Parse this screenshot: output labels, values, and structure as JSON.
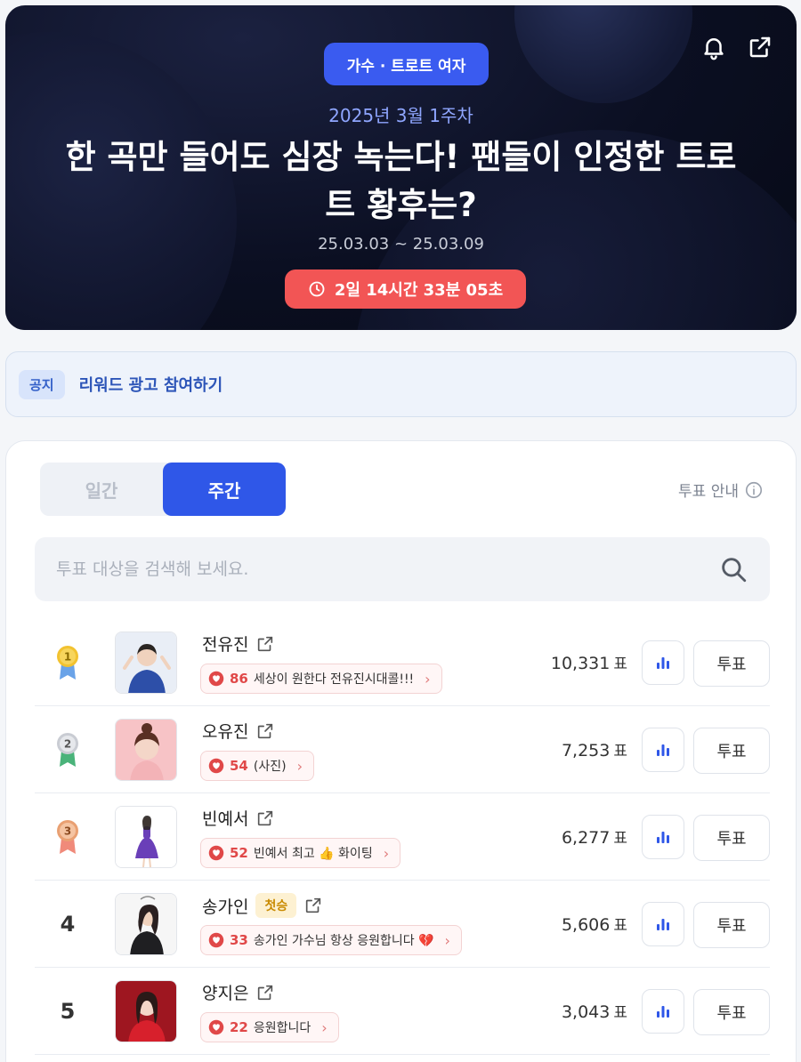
{
  "hero": {
    "category": "가수 · 트로트 여자",
    "week": "2025년 3월 1주차",
    "title": "한 곡만 들어도 심장 녹는다! 팬들이 인정한 트로트 황후는?",
    "date_range": "25.03.03 ~ 25.03.09",
    "timer": "2일 14시간 33분 05초",
    "icons": [
      "bell-icon",
      "share-icon"
    ]
  },
  "notice": {
    "tag": "공지",
    "text": "리워드 광고 참여하기"
  },
  "tabs": {
    "daily": "일간",
    "weekly": "주간",
    "active": "weekly"
  },
  "guide_label": "투표 안내",
  "search": {
    "placeholder": "투표 대상을 검색해 보세요."
  },
  "vote_unit": "표",
  "vote_button": "투표",
  "candidates": [
    {
      "rank": "1",
      "name": "전유진",
      "first_win": "",
      "cheer_count": "86",
      "cheer_text": "세상이 원한다 전유진시대콜!!!",
      "votes": "10,331",
      "medal": "gold"
    },
    {
      "rank": "2",
      "name": "오유진",
      "first_win": "",
      "cheer_count": "54",
      "cheer_text": "(사진)",
      "votes": "7,253",
      "medal": "silver"
    },
    {
      "rank": "3",
      "name": "빈예서",
      "first_win": "",
      "cheer_count": "52",
      "cheer_text": "빈예서 최고 👍 화이팅",
      "votes": "6,277",
      "medal": "bronze"
    },
    {
      "rank": "4",
      "name": "송가인",
      "first_win": "첫승",
      "cheer_count": "33",
      "cheer_text": "송가인 가수님 항상 응원합니다 💔",
      "votes": "5,606",
      "medal": ""
    },
    {
      "rank": "5",
      "name": "양지은",
      "first_win": "",
      "cheer_count": "22",
      "cheer_text": "응원합니다",
      "votes": "3,043",
      "medal": ""
    }
  ],
  "colors": {
    "accent": "#2f57e8",
    "timer": "#f25555",
    "gold": "#f2c230",
    "silver": "#c9ccd3",
    "bronze": "#e9a072"
  }
}
